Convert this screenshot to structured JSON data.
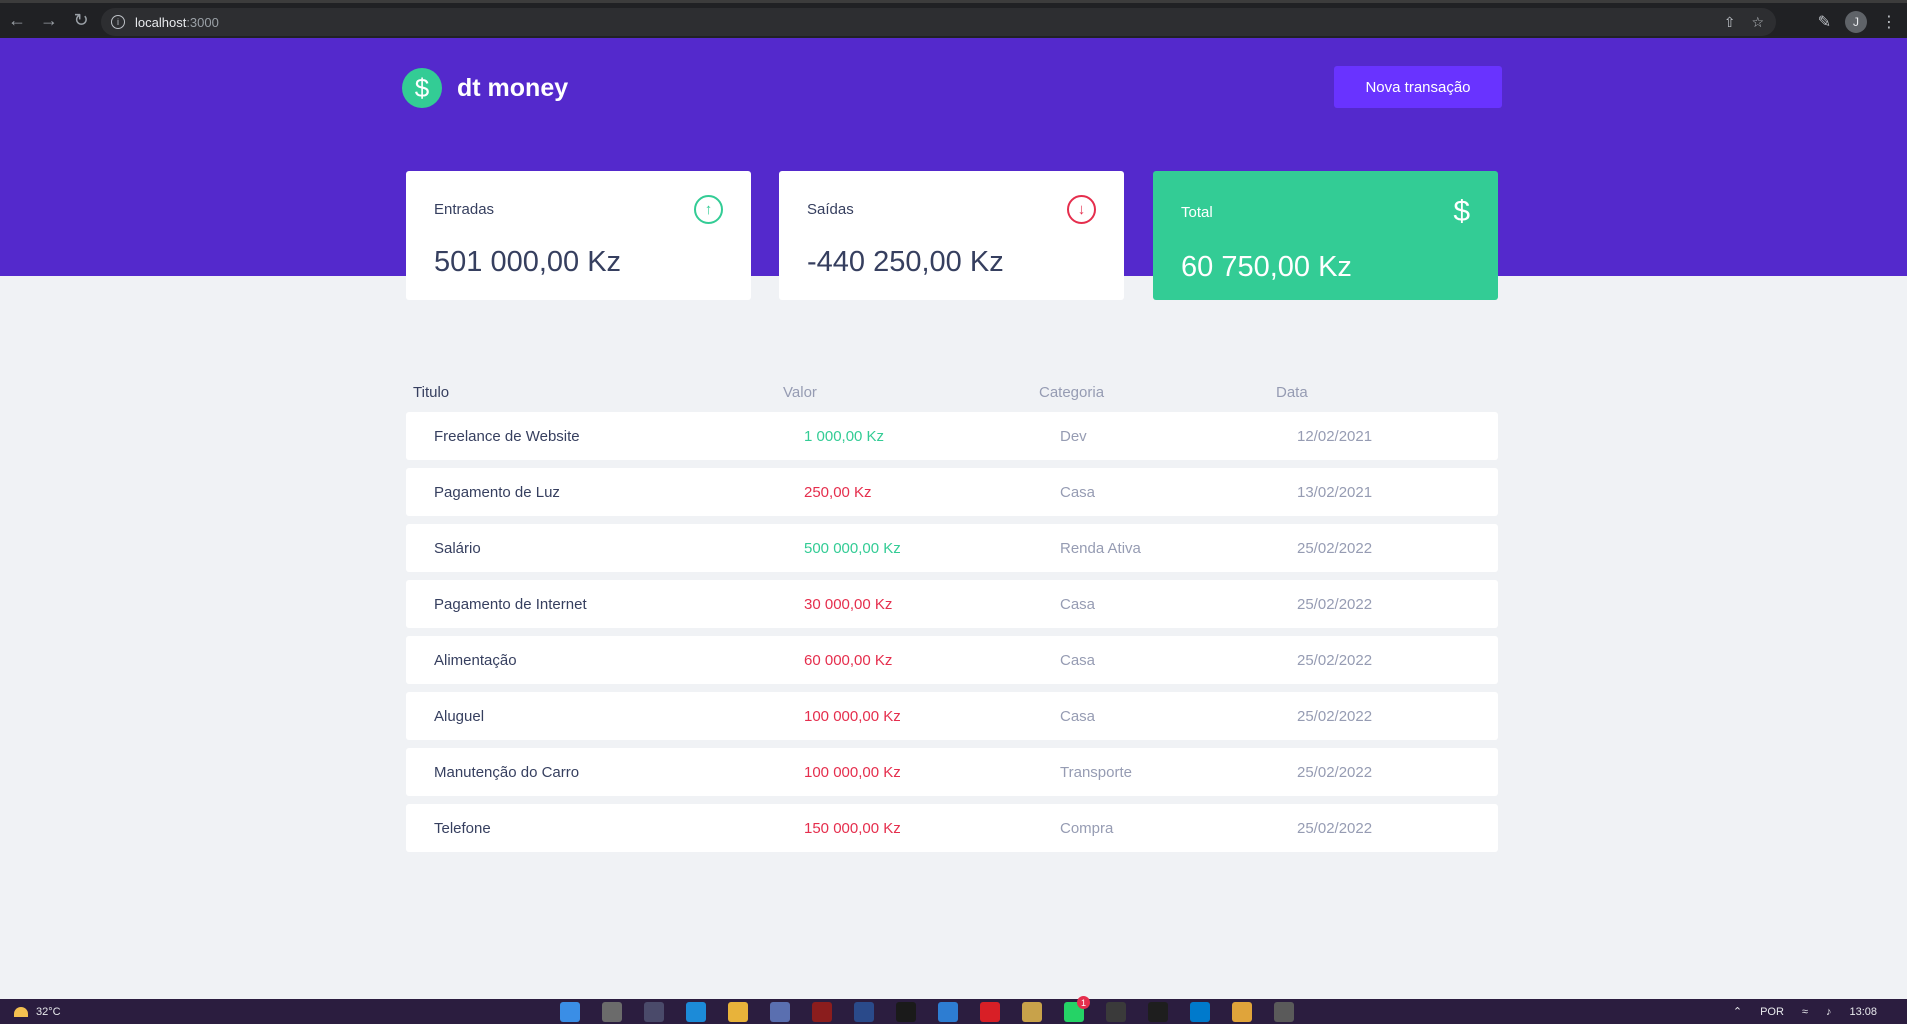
{
  "browser": {
    "url_host": "localhost",
    "url_port": ":3000",
    "profile_initial": "J"
  },
  "header": {
    "logo_symbol": "$",
    "logo_text": "dt money",
    "new_transaction_label": "Nova transação",
    "background": "#5429cc",
    "button_color": "#6933ff"
  },
  "summary": {
    "income": {
      "label": "Entradas",
      "value": "501 000,00 Kz",
      "icon": "arrow-up-circle-icon"
    },
    "outcome": {
      "label": "Saídas",
      "value": "-440 250,00 Kz",
      "icon": "arrow-down-circle-icon"
    },
    "total": {
      "label": "Total",
      "value": "60 750,00 Kz",
      "icon": "dollar-icon",
      "color": "#33cc95"
    }
  },
  "table": {
    "headers": {
      "title": "Titulo",
      "value": "Valor",
      "category": "Categoria",
      "date": "Data"
    },
    "rows": [
      {
        "title": "Freelance de Website",
        "value": "1 000,00 Kz",
        "type": "income",
        "category": "Dev",
        "date": "12/02/2021"
      },
      {
        "title": "Pagamento de Luz",
        "value": "250,00 Kz",
        "type": "expense",
        "category": "Casa",
        "date": "13/02/2021"
      },
      {
        "title": "Salário",
        "value": "500 000,00 Kz",
        "type": "income",
        "category": "Renda Ativa",
        "date": "25/02/2022"
      },
      {
        "title": "Pagamento de Internet",
        "value": "30 000,00 Kz",
        "type": "expense",
        "category": "Casa",
        "date": "25/02/2022"
      },
      {
        "title": "Alimentação",
        "value": "60 000,00 Kz",
        "type": "expense",
        "category": "Casa",
        "date": "25/02/2022"
      },
      {
        "title": "Aluguel",
        "value": "100 000,00 Kz",
        "type": "expense",
        "category": "Casa",
        "date": "25/02/2022"
      },
      {
        "title": "Manutenção do Carro",
        "value": "100 000,00 Kz",
        "type": "expense",
        "category": "Transporte",
        "date": "25/02/2022"
      },
      {
        "title": "Telefone",
        "value": "150 000,00 Kz",
        "type": "expense",
        "category": "Compra",
        "date": "25/02/2022"
      }
    ],
    "income_color": "#33cc95",
    "expense_color": "#e52e4d"
  },
  "taskbar": {
    "temperature": "32°C",
    "language": "POR",
    "time": "13:08",
    "notification_count": "1"
  }
}
